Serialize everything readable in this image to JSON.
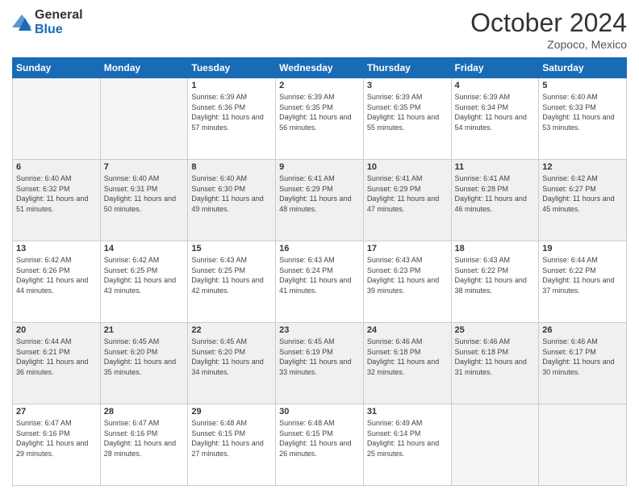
{
  "header": {
    "logo_line1": "General",
    "logo_line2": "Blue",
    "month": "October 2024",
    "location": "Zopoco, Mexico"
  },
  "weekdays": [
    "Sunday",
    "Monday",
    "Tuesday",
    "Wednesday",
    "Thursday",
    "Friday",
    "Saturday"
  ],
  "weeks": [
    [
      {
        "day": "",
        "empty": true
      },
      {
        "day": "",
        "empty": true
      },
      {
        "day": "1",
        "sunrise": "6:39 AM",
        "sunset": "6:36 PM",
        "daylight": "11 hours and 57 minutes."
      },
      {
        "day": "2",
        "sunrise": "6:39 AM",
        "sunset": "6:35 PM",
        "daylight": "11 hours and 56 minutes."
      },
      {
        "day": "3",
        "sunrise": "6:39 AM",
        "sunset": "6:35 PM",
        "daylight": "11 hours and 55 minutes."
      },
      {
        "day": "4",
        "sunrise": "6:39 AM",
        "sunset": "6:34 PM",
        "daylight": "11 hours and 54 minutes."
      },
      {
        "day": "5",
        "sunrise": "6:40 AM",
        "sunset": "6:33 PM",
        "daylight": "11 hours and 53 minutes."
      }
    ],
    [
      {
        "day": "6",
        "sunrise": "6:40 AM",
        "sunset": "6:32 PM",
        "daylight": "11 hours and 51 minutes."
      },
      {
        "day": "7",
        "sunrise": "6:40 AM",
        "sunset": "6:31 PM",
        "daylight": "11 hours and 50 minutes."
      },
      {
        "day": "8",
        "sunrise": "6:40 AM",
        "sunset": "6:30 PM",
        "daylight": "11 hours and 49 minutes."
      },
      {
        "day": "9",
        "sunrise": "6:41 AM",
        "sunset": "6:29 PM",
        "daylight": "11 hours and 48 minutes."
      },
      {
        "day": "10",
        "sunrise": "6:41 AM",
        "sunset": "6:29 PM",
        "daylight": "11 hours and 47 minutes."
      },
      {
        "day": "11",
        "sunrise": "6:41 AM",
        "sunset": "6:28 PM",
        "daylight": "11 hours and 46 minutes."
      },
      {
        "day": "12",
        "sunrise": "6:42 AM",
        "sunset": "6:27 PM",
        "daylight": "11 hours and 45 minutes."
      }
    ],
    [
      {
        "day": "13",
        "sunrise": "6:42 AM",
        "sunset": "6:26 PM",
        "daylight": "11 hours and 44 minutes."
      },
      {
        "day": "14",
        "sunrise": "6:42 AM",
        "sunset": "6:25 PM",
        "daylight": "11 hours and 43 minutes."
      },
      {
        "day": "15",
        "sunrise": "6:43 AM",
        "sunset": "6:25 PM",
        "daylight": "11 hours and 42 minutes."
      },
      {
        "day": "16",
        "sunrise": "6:43 AM",
        "sunset": "6:24 PM",
        "daylight": "11 hours and 41 minutes."
      },
      {
        "day": "17",
        "sunrise": "6:43 AM",
        "sunset": "6:23 PM",
        "daylight": "11 hours and 39 minutes."
      },
      {
        "day": "18",
        "sunrise": "6:43 AM",
        "sunset": "6:22 PM",
        "daylight": "11 hours and 38 minutes."
      },
      {
        "day": "19",
        "sunrise": "6:44 AM",
        "sunset": "6:22 PM",
        "daylight": "11 hours and 37 minutes."
      }
    ],
    [
      {
        "day": "20",
        "sunrise": "6:44 AM",
        "sunset": "6:21 PM",
        "daylight": "11 hours and 36 minutes."
      },
      {
        "day": "21",
        "sunrise": "6:45 AM",
        "sunset": "6:20 PM",
        "daylight": "11 hours and 35 minutes."
      },
      {
        "day": "22",
        "sunrise": "6:45 AM",
        "sunset": "6:20 PM",
        "daylight": "11 hours and 34 minutes."
      },
      {
        "day": "23",
        "sunrise": "6:45 AM",
        "sunset": "6:19 PM",
        "daylight": "11 hours and 33 minutes."
      },
      {
        "day": "24",
        "sunrise": "6:46 AM",
        "sunset": "6:18 PM",
        "daylight": "11 hours and 32 minutes."
      },
      {
        "day": "25",
        "sunrise": "6:46 AM",
        "sunset": "6:18 PM",
        "daylight": "11 hours and 31 minutes."
      },
      {
        "day": "26",
        "sunrise": "6:46 AM",
        "sunset": "6:17 PM",
        "daylight": "11 hours and 30 minutes."
      }
    ],
    [
      {
        "day": "27",
        "sunrise": "6:47 AM",
        "sunset": "6:16 PM",
        "daylight": "11 hours and 29 minutes."
      },
      {
        "day": "28",
        "sunrise": "6:47 AM",
        "sunset": "6:16 PM",
        "daylight": "11 hours and 28 minutes."
      },
      {
        "day": "29",
        "sunrise": "6:48 AM",
        "sunset": "6:15 PM",
        "daylight": "11 hours and 27 minutes."
      },
      {
        "day": "30",
        "sunrise": "6:48 AM",
        "sunset": "6:15 PM",
        "daylight": "11 hours and 26 minutes."
      },
      {
        "day": "31",
        "sunrise": "6:49 AM",
        "sunset": "6:14 PM",
        "daylight": "11 hours and 25 minutes."
      },
      {
        "day": "",
        "empty": true
      },
      {
        "day": "",
        "empty": true
      }
    ]
  ]
}
